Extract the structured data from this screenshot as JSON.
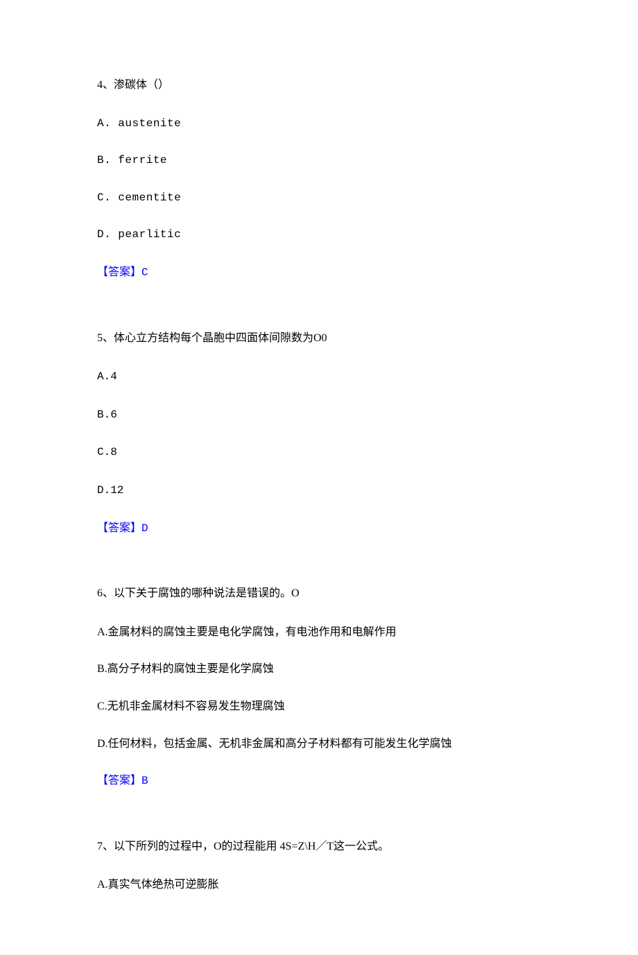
{
  "q4": {
    "number_text": "4、渗碳体（）",
    "options": {
      "a": "A.  austenite",
      "b": "B.  ferrite",
      "c": "C.  cementite",
      "d": "D.  pearlitic"
    },
    "answer_label": "【答案】",
    "answer_value": "C"
  },
  "q5": {
    "number_text": "5、体心立方结构每个晶胞中四面体间隙数为O0",
    "options": {
      "a": "A.4",
      "b": "B.6",
      "c": "C.8",
      "d": "D.12"
    },
    "answer_label": "【答案】",
    "answer_value": "D"
  },
  "q6": {
    "number_text": "6、以下关于腐蚀的哪种说法是错误的。O",
    "options": {
      "a": "A.金属材料的腐蚀主要是电化学腐蚀，有电池作用和电解作用",
      "b": "B.高分子材料的腐蚀主要是化学腐蚀",
      "c": "C.无机非金属材料不容易发生物理腐蚀",
      "d": "D.任何材料，包括金属、无机非金属和高分子材料都有可能发生化学腐蚀"
    },
    "answer_label": "【答案】",
    "answer_value": "B"
  },
  "q7": {
    "number_text": "7、以下所列的过程中，O的过程能用 4S=Z\\H／T这一公式。",
    "options": {
      "a": "A.真实气体绝热可逆膨胀"
    }
  }
}
